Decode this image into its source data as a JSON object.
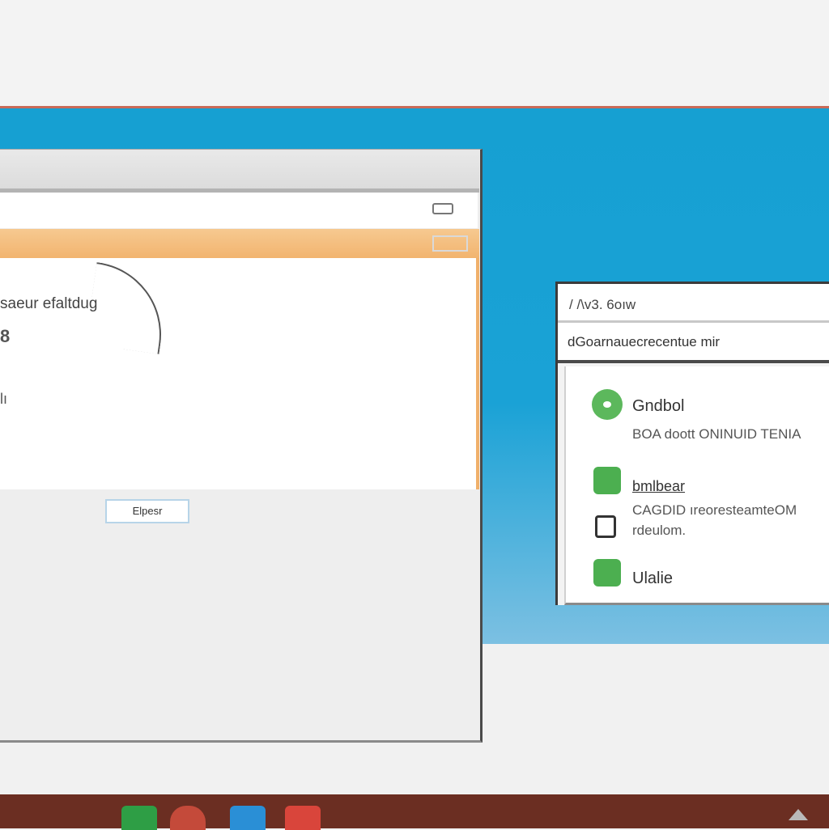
{
  "main_window": {
    "heading": "saeur efaltdug",
    "char_a": "8",
    "char_b": "lı",
    "button_label": "Elpesr"
  },
  "dialog": {
    "title": "/ /\\v3. 6oıw",
    "subtitle": "dGoarnauecrecentue mir",
    "options": [
      {
        "title": "Gndbol",
        "description": "BOA doott ONINUID TENIA",
        "icon": "green-circle-icon"
      },
      {
        "title": "bmlbear",
        "description": "CAGDID ıreoresteamteOM",
        "description2": "rdeulom.",
        "icon": "green-square-icon"
      },
      {
        "title": "Ulalie",
        "icon": "green-square-icon"
      }
    ]
  },
  "taskbar": {
    "icons": [
      "green-app-icon",
      "lock-app-icon",
      "blue-app-icon",
      "red-app-icon"
    ]
  },
  "colors": {
    "desktop": "#16a0d2",
    "accent_orange": "#f2b46f",
    "green": "#4caf50",
    "taskbar": "#6b2e22"
  }
}
